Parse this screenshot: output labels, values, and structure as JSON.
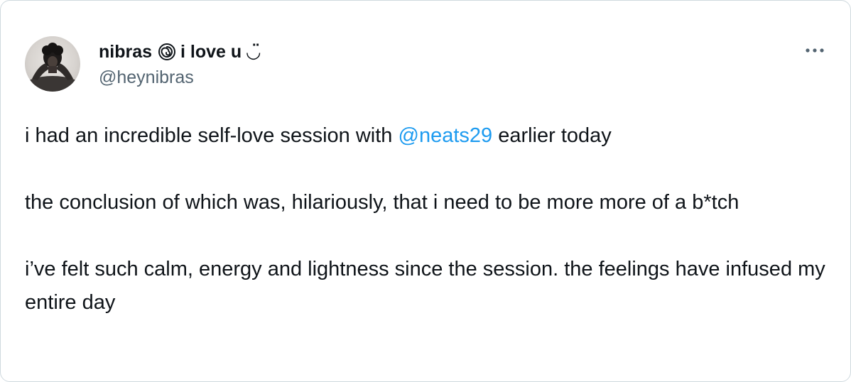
{
  "tweet": {
    "author": {
      "name_first": "nibras",
      "name_emoji_icon": "cyclone-icon",
      "name_rest": "i love u ◡̈",
      "handle": "@heynibras"
    },
    "paragraph_1": {
      "before": "i had an incredible self-love session with ",
      "mention": "@neats29",
      "after": " earlier today"
    },
    "paragraph_2": "the conclusion of which was, hilariously, that i need to be more more of a b*tch",
    "paragraph_3": "i’ve felt such calm, energy and lightness since the session. the feelings have infused my entire day",
    "more_icon": "more-horizontal-icon"
  },
  "colors": {
    "text": "#0f1419",
    "secondary": "#536471",
    "mention": "#1d9bf0",
    "border": "#cfd9de"
  }
}
